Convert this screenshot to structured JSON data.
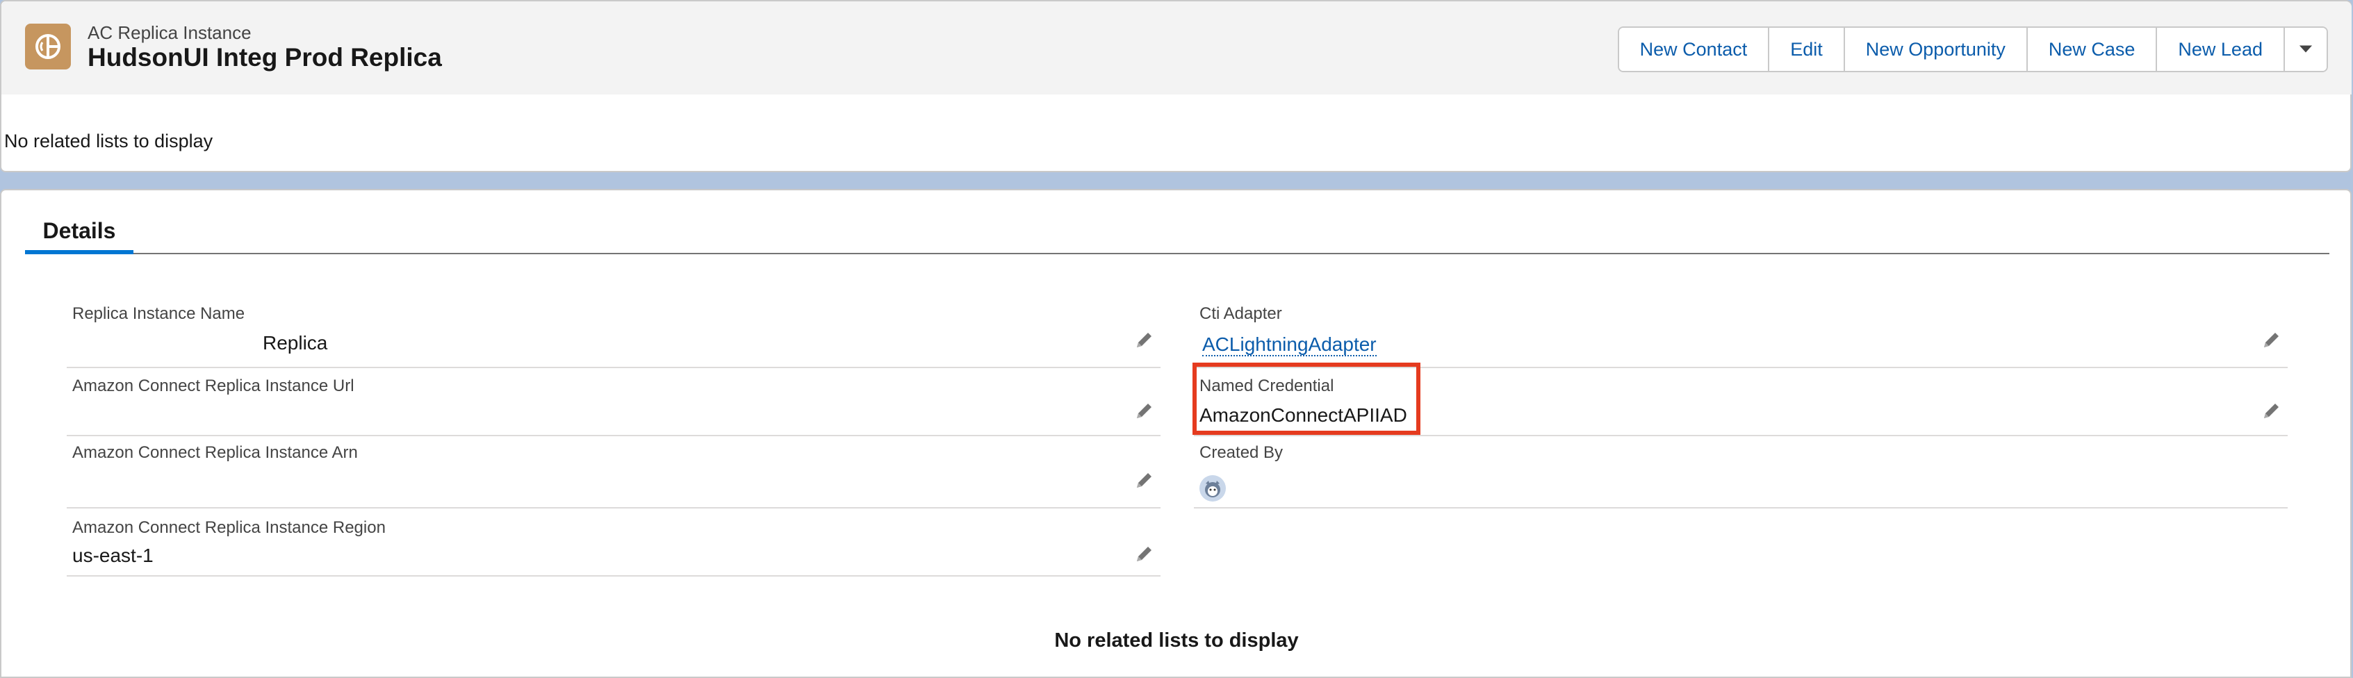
{
  "header": {
    "object_type": "AC Replica Instance",
    "record_title": "HudsonUI Integ Prod Replica",
    "icon": "replica-instance-icon",
    "icon_color": "#c6965f",
    "actions": [
      {
        "label": "New Contact"
      },
      {
        "label": "Edit"
      },
      {
        "label": "New Opportunity"
      },
      {
        "label": "New Case"
      },
      {
        "label": "New Lead"
      }
    ],
    "more_actions_icon": "chevron-down-icon"
  },
  "related_top": {
    "message": "No related lists to display"
  },
  "tabs": {
    "details_label": "Details"
  },
  "details": {
    "left": [
      {
        "label": "Replica Instance Name",
        "value": "Replica"
      },
      {
        "label": "Amazon Connect Replica Instance Url",
        "value": ""
      },
      {
        "label": "Amazon Connect Replica Instance Arn",
        "value": ""
      },
      {
        "label": "Amazon Connect Replica Instance Region",
        "value": "us-east-1"
      }
    ],
    "right": [
      {
        "label": "Cti Adapter",
        "value": "ACLightningAdapter"
      },
      {
        "label": "Named Credential",
        "value": "AmazonConnectAPIIAD"
      },
      {
        "label": "Created By",
        "value": ""
      }
    ]
  },
  "related_bottom": {
    "message": "No related lists to display"
  },
  "colors": {
    "link": "#0b5cab",
    "highlight": "#e53b1f",
    "tab_accent": "#0176d3"
  }
}
